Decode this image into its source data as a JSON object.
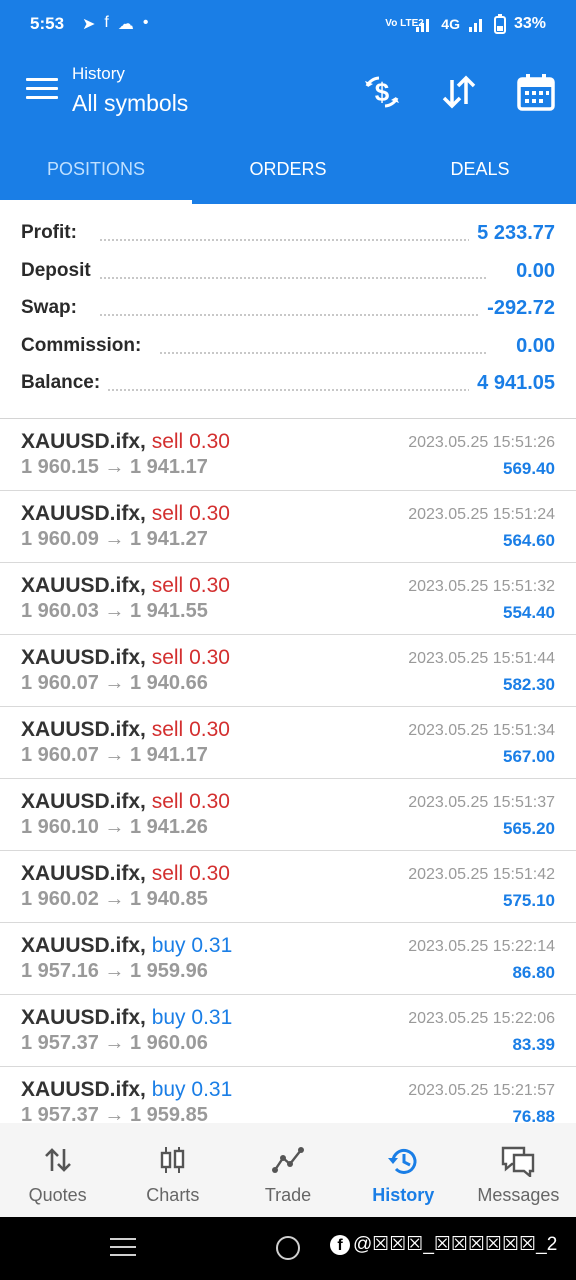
{
  "status": {
    "time": "5:53",
    "network": "4G",
    "volte": "Vo LTE2",
    "battery": "33%"
  },
  "header": {
    "subtitle": "History",
    "title": "All symbols"
  },
  "tabs": [
    {
      "label": "POSITIONS",
      "active": true
    },
    {
      "label": "ORDERS",
      "active": false
    },
    {
      "label": "DEALS",
      "active": false
    }
  ],
  "summary": [
    {
      "label": "Profit:",
      "value": "5 233.77"
    },
    {
      "label": "Deposit",
      "value": "0.00"
    },
    {
      "label": "Swap:",
      "value": "-292.72"
    },
    {
      "label": "Commission:",
      "value": "0.00"
    },
    {
      "label": "Balance:",
      "value": "4 941.05"
    }
  ],
  "positions": [
    {
      "symbol": "XAUUSD.ifx,",
      "side": "sell",
      "lots": "0.30",
      "open": "1 960.15",
      "close": "1 941.17",
      "time": "2023.05.25 15:51:26",
      "profit": "569.40"
    },
    {
      "symbol": "XAUUSD.ifx,",
      "side": "sell",
      "lots": "0.30",
      "open": "1 960.09",
      "close": "1 941.27",
      "time": "2023.05.25 15:51:24",
      "profit": "564.60"
    },
    {
      "symbol": "XAUUSD.ifx,",
      "side": "sell",
      "lots": "0.30",
      "open": "1 960.03",
      "close": "1 941.55",
      "time": "2023.05.25 15:51:32",
      "profit": "554.40"
    },
    {
      "symbol": "XAUUSD.ifx,",
      "side": "sell",
      "lots": "0.30",
      "open": "1 960.07",
      "close": "1 940.66",
      "time": "2023.05.25 15:51:44",
      "profit": "582.30"
    },
    {
      "symbol": "XAUUSD.ifx,",
      "side": "sell",
      "lots": "0.30",
      "open": "1 960.07",
      "close": "1 941.17",
      "time": "2023.05.25 15:51:34",
      "profit": "567.00"
    },
    {
      "symbol": "XAUUSD.ifx,",
      "side": "sell",
      "lots": "0.30",
      "open": "1 960.10",
      "close": "1 941.26",
      "time": "2023.05.25 15:51:37",
      "profit": "565.20"
    },
    {
      "symbol": "XAUUSD.ifx,",
      "side": "sell",
      "lots": "0.30",
      "open": "1 960.02",
      "close": "1 940.85",
      "time": "2023.05.25 15:51:42",
      "profit": "575.10"
    },
    {
      "symbol": "XAUUSD.ifx,",
      "side": "buy",
      "lots": "0.31",
      "open": "1 957.16",
      "close": "1 959.96",
      "time": "2023.05.25 15:22:14",
      "profit": "86.80"
    },
    {
      "symbol": "XAUUSD.ifx,",
      "side": "buy",
      "lots": "0.31",
      "open": "1 957.37",
      "close": "1 960.06",
      "time": "2023.05.25 15:22:06",
      "profit": "83.39"
    },
    {
      "symbol": "XAUUSD.ifx,",
      "side": "buy",
      "lots": "0.31",
      "open": "1 957.37",
      "close": "1 959.85",
      "time": "2023.05.25 15:21:57",
      "profit": "76.88"
    }
  ],
  "bottom_nav": [
    {
      "label": "Quotes",
      "icon": "quotes-icon",
      "active": false
    },
    {
      "label": "Charts",
      "icon": "charts-icon",
      "active": false
    },
    {
      "label": "Trade",
      "icon": "trade-icon",
      "active": false
    },
    {
      "label": "History",
      "icon": "history-icon",
      "active": true
    },
    {
      "label": "Messages",
      "icon": "messages-icon",
      "active": false
    }
  ],
  "watermark": "@☒☒☒_☒☒☒☒☒☒_2",
  "arrow": "→",
  "colors": {
    "primary": "#1a7ee6",
    "sell": "#d32f2f",
    "buy": "#1a7ee6",
    "muted": "#9a9a9a"
  }
}
